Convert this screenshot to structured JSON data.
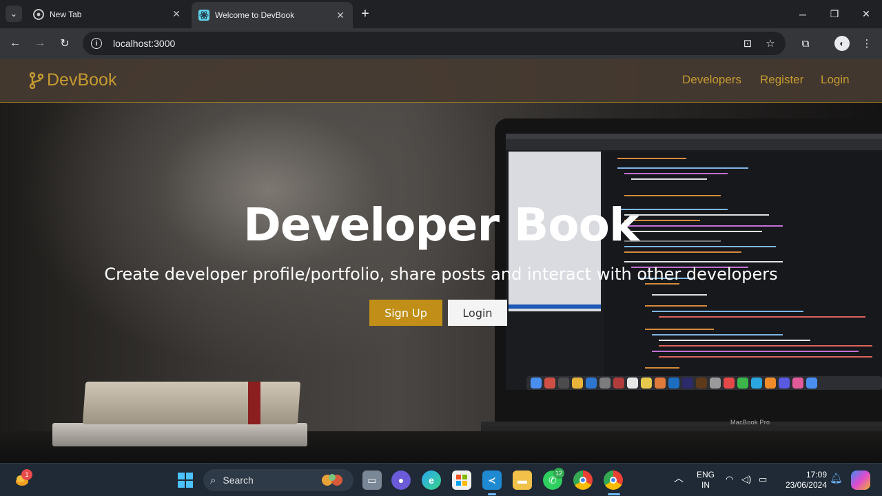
{
  "browser": {
    "tabs": [
      {
        "title": "New Tab",
        "active": false
      },
      {
        "title": "Welcome to DevBook",
        "active": true
      }
    ],
    "url": "localhost:3000"
  },
  "site": {
    "brand": "DevBook",
    "nav": [
      "Developers",
      "Register",
      "Login"
    ],
    "hero": {
      "title": "Developer Book",
      "subtitle": "Create developer profile/portfolio, share posts and interact with other developers",
      "primary_button": "Sign Up",
      "secondary_button": "Login"
    },
    "laptop_label": "MacBook Pro",
    "colors": {
      "accent": "#c59b32",
      "button_primary": "#c18f18",
      "navbar": "#463a30"
    }
  },
  "taskbar": {
    "search_placeholder": "Search",
    "language": [
      "ENG",
      "IN"
    ],
    "time": "17:09",
    "date": "23/06/2024",
    "weather_badge": "1",
    "whatsapp_badge": "12",
    "pinned": [
      "file-explorer-icon",
      "copilot-icon",
      "edge-icon",
      "store-icon",
      "vscode-icon",
      "folder-icon",
      "whatsapp-icon",
      "chrome-icon",
      "chrome-active-icon"
    ]
  }
}
